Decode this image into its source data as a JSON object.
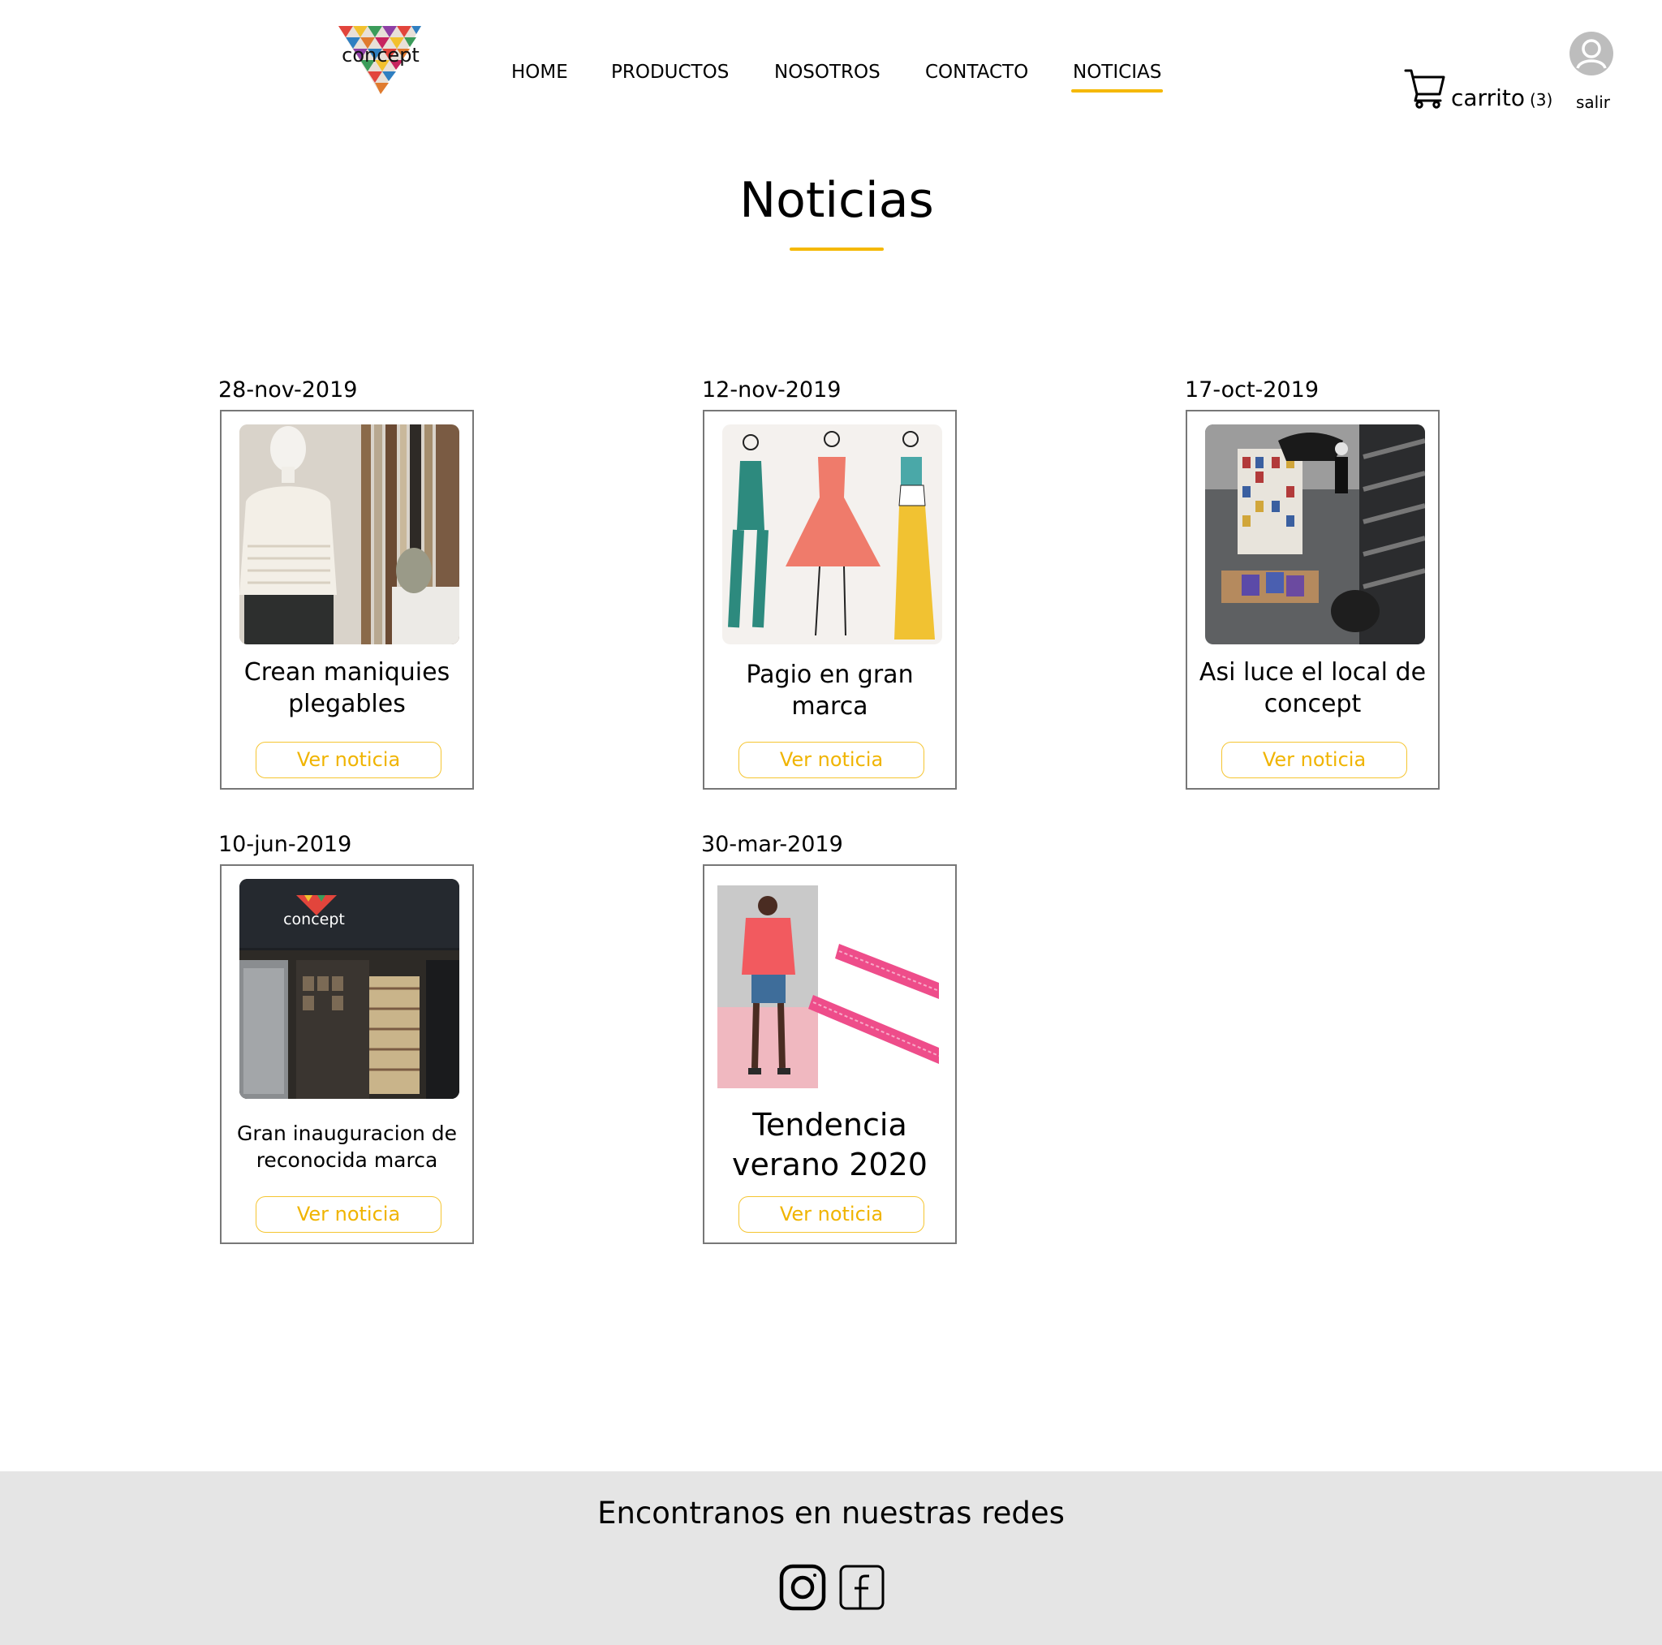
{
  "header": {
    "logo_text": "concept",
    "nav": [
      {
        "label": "HOME"
      },
      {
        "label": "PRODUCTOS"
      },
      {
        "label": "NOSOTROS"
      },
      {
        "label": "CONTACTO"
      },
      {
        "label": "NOTICIAS",
        "active": true
      }
    ],
    "cart": {
      "label": "carrito",
      "count": "(3)"
    },
    "user": {
      "logout_label": "salir"
    }
  },
  "page": {
    "title": "Noticias"
  },
  "news": [
    {
      "date": "28-nov-2019",
      "title": "Crean maniquies plegables",
      "button": "Ver noticia",
      "image": "mannequin-photo"
    },
    {
      "date": "12-nov-2019",
      "title": "Pagio en gran marca",
      "button": "Ver noticia",
      "image": "fashion-sketch"
    },
    {
      "date": "17-oct-2019",
      "title": "Asi luce el local de concept",
      "button": "Ver noticia",
      "image": "store-interior-photo"
    },
    {
      "date": "10-jun-2019",
      "title": "Gran inauguracion de reconocida marca",
      "button": "Ver noticia",
      "image": "storefront-photo",
      "image_text": "concept"
    },
    {
      "date": "30-mar-2019",
      "title": "Tendencia verano 2020",
      "button": "Ver noticia",
      "image": "summer-trend-collage"
    }
  ],
  "footer": {
    "text": "Encontranos en nuestras redes",
    "social": [
      "instagram-icon",
      "facebook-icon"
    ]
  },
  "colors": {
    "accent": "#f5b800",
    "card_border": "#777777",
    "footer_bg": "#e5e5e5"
  }
}
